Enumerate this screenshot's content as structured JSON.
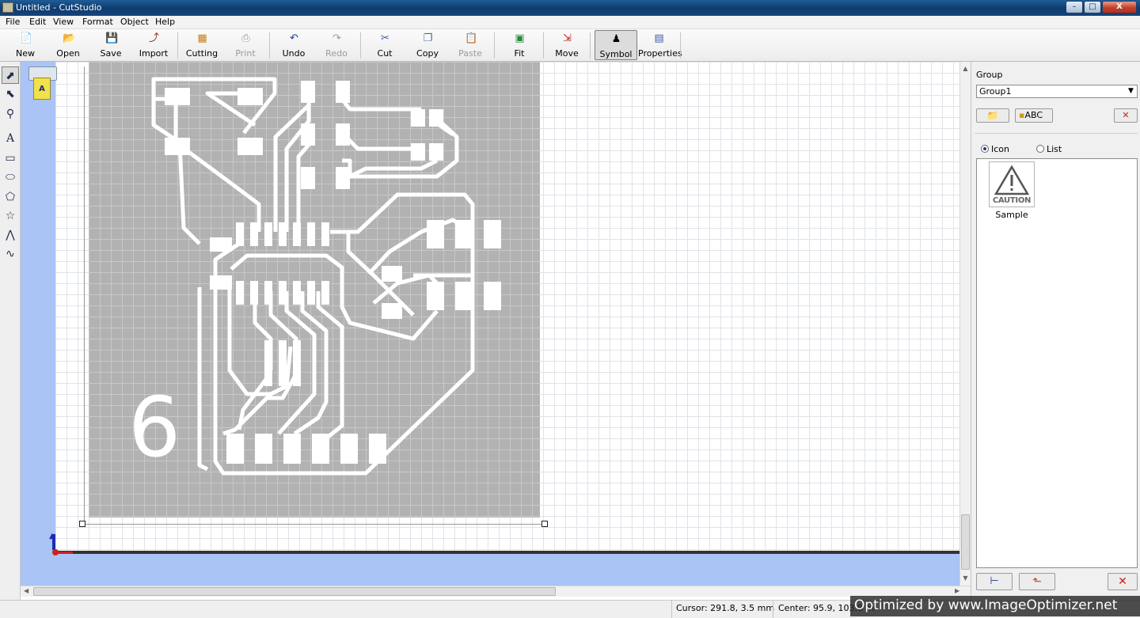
{
  "window": {
    "title": "Untitled - CutStudio",
    "controls": {
      "minimize": "–",
      "maximize": "□",
      "close": "X"
    }
  },
  "menu": [
    "File",
    "Edit",
    "View",
    "Format",
    "Object",
    "Help"
  ],
  "toolbar": {
    "new": "New",
    "open": "Open",
    "save": "Save",
    "import": "Import",
    "cutting": "Cutting",
    "print": "Print",
    "undo": "Undo",
    "redo": "Redo",
    "cut": "Cut",
    "copy": "Copy",
    "paste": "Paste",
    "fit": "Fit",
    "move": "Move",
    "symbol": "Symbol",
    "properties": "Properties"
  },
  "tools": [
    "select-arrow-icon",
    "node-edit-icon",
    "zoom-icon",
    "text-icon",
    "rectangle-icon",
    "ellipse-icon",
    "polygon-icon",
    "star-icon",
    "polyline-icon",
    "curve-icon"
  ],
  "canvas": {
    "pcb_label": "6",
    "grid_color": "#dfe3e8",
    "board_color": "#b2b2b2"
  },
  "panel": {
    "group_label": "Group",
    "group_value": "Group1",
    "abc_button": "ABC",
    "view_icon": "Icon",
    "view_list": "List",
    "symbol_caution_text": "CAUTION",
    "symbol_name": "Sample"
  },
  "status": {
    "cursor": "Cursor: 291.8, 3.5 mm",
    "center": "Center: 95.9, 103.8 m"
  },
  "watermark": "Optimized by www.ImageOptimizer.net"
}
